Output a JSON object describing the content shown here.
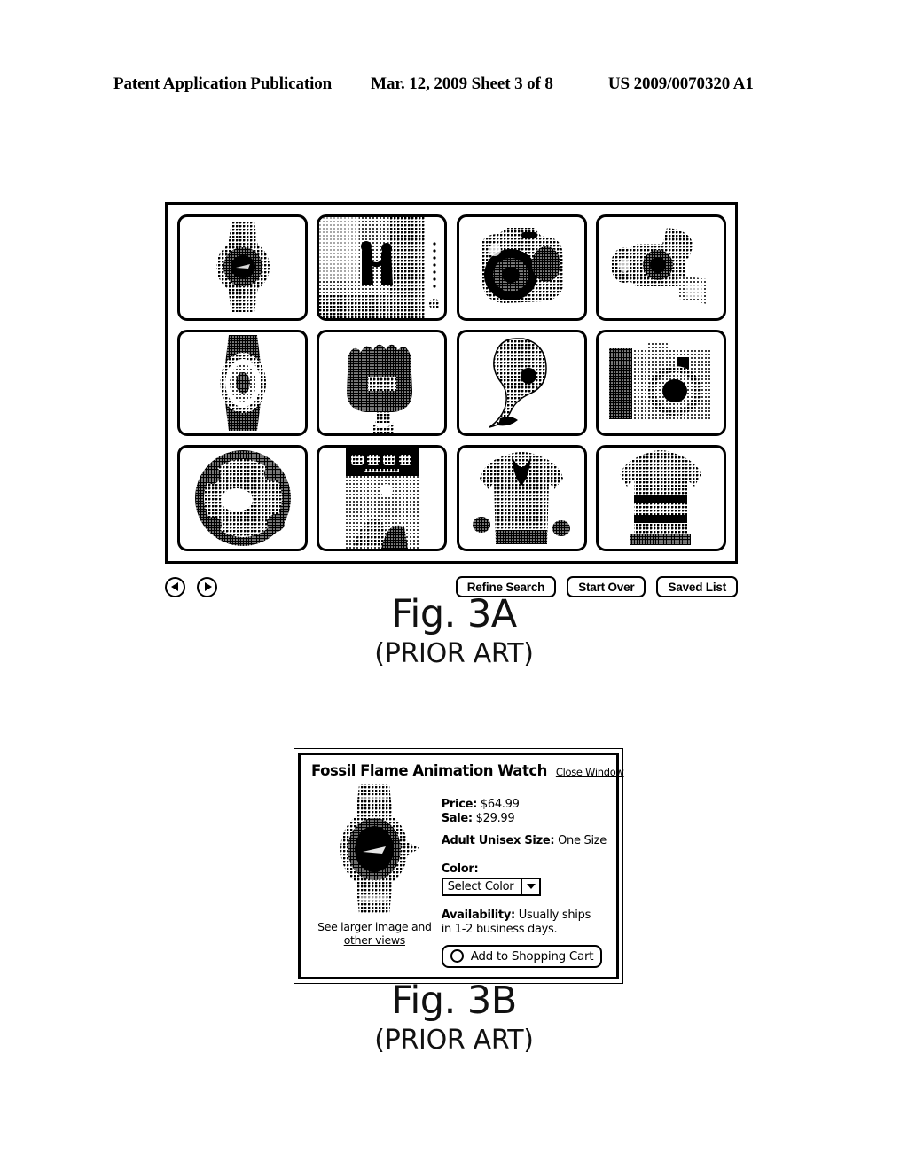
{
  "header": {
    "publication": "Patent Application Publication",
    "date_sheet": "Mar. 12, 2009  Sheet 3 of 8",
    "patent_number": "US 2009/0070320 A1"
  },
  "fig3a": {
    "caption_number": "Fig. 3A",
    "caption_sub": "(PRIOR ART)",
    "grid": [
      [
        {
          "name": "wrist-watch-dark-dial",
          "icon": "watch-round"
        },
        {
          "name": "people-photo",
          "icon": "photo-people"
        },
        {
          "name": "dslr-camera",
          "icon": "dslr"
        },
        {
          "name": "camcorder",
          "icon": "camcorder"
        }
      ],
      [
        {
          "name": "wrist-watch-oval",
          "icon": "watch-oval"
        },
        {
          "name": "pocket-watch-pendant",
          "icon": "pendant"
        },
        {
          "name": "bluetooth-headset",
          "icon": "headset"
        },
        {
          "name": "compact-camera",
          "icon": "compact-camera"
        }
      ],
      [
        {
          "name": "holiday-wreath",
          "icon": "wreath"
        },
        {
          "name": "poster-print",
          "icon": "poster"
        },
        {
          "name": "mens-jacket",
          "icon": "jacket"
        },
        {
          "name": "striped-sweater",
          "icon": "sweater"
        }
      ]
    ],
    "toolbar": {
      "back_icon": "back-arrow-icon",
      "forward_icon": "forward-arrow-icon",
      "buttons": [
        {
          "label": "Refine Search"
        },
        {
          "label": "Start Over"
        },
        {
          "label": "Saved List"
        }
      ]
    }
  },
  "fig3b": {
    "caption_number": "Fig. 3B",
    "caption_sub": "(PRIOR ART)",
    "dialog": {
      "title": "Fossil Flame Animation Watch",
      "close_label": "Close Window",
      "product_image_name": "fossil-watch-photo",
      "see_larger_line1": "See larger image and",
      "see_larger_line2": "other views",
      "price_label": "Price:",
      "price_value": "$64.99",
      "sale_label": "Sale:",
      "sale_value": "$29.99",
      "size_label": "Adult Unisex Size:",
      "size_value": "One Size",
      "color_label": "Color:",
      "color_selected": "Select Color",
      "availability_label": "Availability:",
      "availability_value_line1": "Usually ships",
      "availability_value_line2": "in 1-2 business days.",
      "cart_button_label": "Add to Shopping Cart"
    }
  }
}
